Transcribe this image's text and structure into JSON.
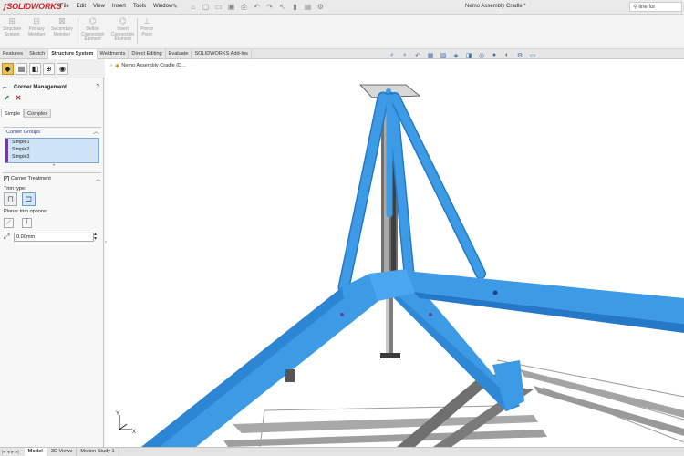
{
  "app": {
    "logo_text": "SOLIDWORKS",
    "document_title": "Nemo Assembly Cradle *",
    "search_text": "line for"
  },
  "menu": [
    "File",
    "Edit",
    "View",
    "Insert",
    "Tools",
    "Window"
  ],
  "quick_access_icons": [
    "home-icon",
    "new-document-icon",
    "open-icon",
    "save-icon",
    "print-icon",
    "undo-icon",
    "redo-icon",
    "select-icon",
    "rebuild-icon",
    "file-properties-icon",
    "options-icon"
  ],
  "command_manager": [
    {
      "label": "Structure\nSystem",
      "icon": "structure-system-icon"
    },
    {
      "label": "Primary\nMember",
      "icon": "primary-member-icon"
    },
    {
      "label": "Secondary\nMember",
      "icon": "secondary-member-icon"
    },
    {
      "label": "Define\nConnection\nElement",
      "icon": "define-connection-icon"
    },
    {
      "label": "Insert\nConnection\nElement",
      "icon": "insert-connection-icon"
    },
    {
      "label": "Pierce\nPoint",
      "icon": "pierce-point-icon"
    }
  ],
  "tabs": [
    "Features",
    "Sketch",
    "Structure System",
    "Weldments",
    "Direct Editing",
    "Evaluate",
    "SOLIDWORKS Add-Ins"
  ],
  "active_tab": "Structure System",
  "property_manager": {
    "title": "Corner Management",
    "help": "?",
    "ok": "✔",
    "cancel": "✕",
    "subtabs": [
      "Simple",
      "Complex"
    ],
    "active_subtab": "Simple",
    "corner_groups_label": "Corner Groups",
    "corner_groups": [
      "Simple1",
      "Simple2",
      "Simple3"
    ],
    "corner_treatment_label": "Corner Treatment",
    "corner_treatment_checked": true,
    "trim_type_label": "Trim type:",
    "planar_trim_label": "Planar trim options:",
    "gap_value": "0.00mm"
  },
  "graphics": {
    "tree_label": "Nemo Assembly Cradle (D..."
  },
  "bottom_tabs": [
    "Model",
    "3D Views",
    "Motion Study 1"
  ],
  "active_bottom_tab": "Model",
  "colors": {
    "member_blue": "#3d9be6",
    "member_blue_dark": "#2578c8",
    "steel_grey": "#8a8a8a",
    "accent_purple": "#6a3fa0",
    "logo_red": "#c8252c"
  }
}
